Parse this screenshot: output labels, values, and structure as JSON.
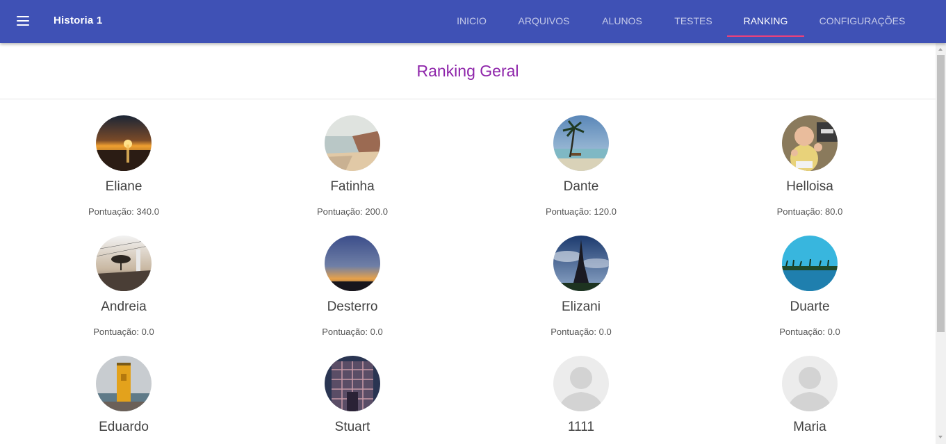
{
  "app": {
    "title": "Historia 1",
    "menu_icon": "hamburger-menu-icon"
  },
  "nav": {
    "tabs": [
      {
        "label": "INICIO",
        "active": false
      },
      {
        "label": "ARQUIVOS",
        "active": false
      },
      {
        "label": "ALUNOS",
        "active": false
      },
      {
        "label": "TESTES",
        "active": false
      },
      {
        "label": "RANKING",
        "active": true
      },
      {
        "label": "CONFIGURAÇÕES",
        "active": false
      }
    ]
  },
  "page": {
    "title": "Ranking Geral",
    "score_label": "Pontuação:"
  },
  "students": [
    {
      "name": "Eliane",
      "score": "340.0",
      "avatar": "sunset-sea-photo"
    },
    {
      "name": "Fatinha",
      "score": "200.0",
      "avatar": "coast-cliff-photo"
    },
    {
      "name": "Dante",
      "score": "120.0",
      "avatar": "palm-beach-photo"
    },
    {
      "name": "Helloisa",
      "score": "80.0",
      "avatar": "baby-photo"
    },
    {
      "name": "Andreia",
      "score": "0.0",
      "avatar": "promenade-photo"
    },
    {
      "name": "Desterro",
      "score": "0.0",
      "avatar": "dusk-horizon-photo"
    },
    {
      "name": "Elizani",
      "score": "0.0",
      "avatar": "eiffel-tower-photo"
    },
    {
      "name": "Duarte",
      "score": "0.0",
      "avatar": "tropical-island-photo"
    },
    {
      "name": "Eduardo",
      "score": "",
      "avatar": "lighthouse-photo"
    },
    {
      "name": "Stuart",
      "score": "",
      "avatar": "building-facade-photo"
    },
    {
      "name": "1111",
      "score": "",
      "avatar": "default-user-icon"
    },
    {
      "name": "Maria",
      "score": "",
      "avatar": "default-user-icon"
    }
  ],
  "colors": {
    "appbar": "#3f51b5",
    "tab_indicator": "#ec407a",
    "page_title": "#8e24aa"
  }
}
